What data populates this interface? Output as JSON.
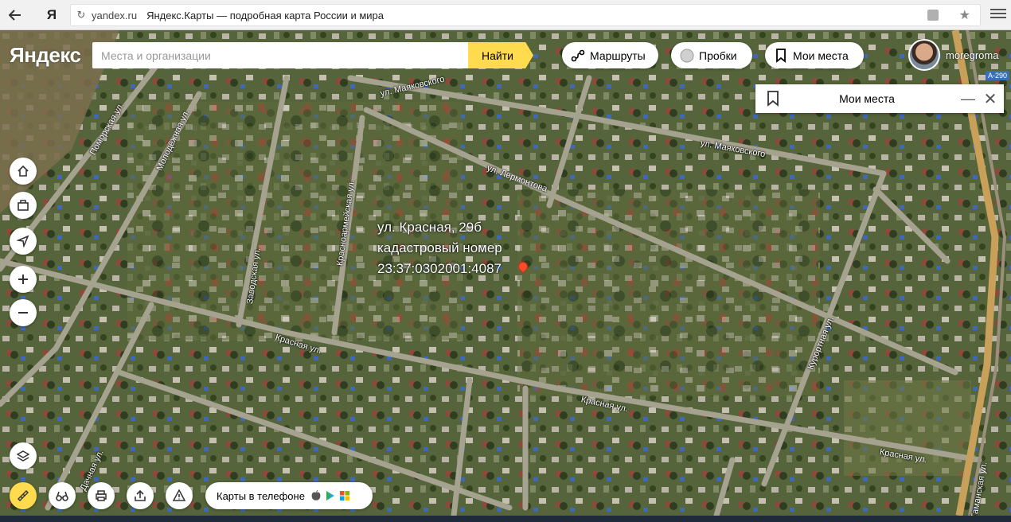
{
  "browser": {
    "back_icon": "arrow-left-icon",
    "yandex_button": "Я",
    "url_host": "yandex.ru",
    "page_title": "Яндекс.Карты — подробная карта России и мира"
  },
  "header": {
    "logo": "Яндекс",
    "search_placeholder": "Места и организации",
    "find_label": "Найти",
    "routes_label": "Маршруты",
    "traffic_label": "Пробки",
    "my_places_label": "Мои места",
    "username": "moregroma",
    "road_badge": "A-290"
  },
  "panel": {
    "title": "Мои места"
  },
  "controls": {
    "left": [
      "home-icon",
      "briefcase-icon",
      "locate-icon",
      "zoom-in-icon",
      "zoom-out-icon"
    ],
    "bottom": [
      "layers-icon",
      "ruler-icon",
      "binoculars-icon",
      "print-icon",
      "share-icon",
      "warning-icon"
    ]
  },
  "caption": {
    "line1": "ул. Красная, 29б",
    "line2": "кадастровый номер",
    "line3": "23:37:0302001:4087"
  },
  "streets": {
    "mayakovskogo_1": "ул. Маяковского",
    "mayakovskogo_2": "ул. Маяковского",
    "lermontova": "ул. Лермонтова",
    "krasnaya_1": "Красная ул.",
    "krasnaya_2": "Красная ул.",
    "krasnaya_3": "Красная ул.",
    "tamanskaya": "Таманская ул.",
    "pomorskaya": "Поморская ул.",
    "molodezhnaya": "Молодёжная ул.",
    "krasnoarmeyskaya": "Красноармейская ул.",
    "zavodskaya": "Заводская ул.",
    "kurortnaya": "Курортная ул.",
    "dachnaya": "Дачная ул."
  },
  "phone_promo": {
    "label": "Карты в телефоне"
  },
  "colors": {
    "accent": "#ffdb4d",
    "pin": "#ff4b2b",
    "satellite_base": "#4f5e35"
  }
}
